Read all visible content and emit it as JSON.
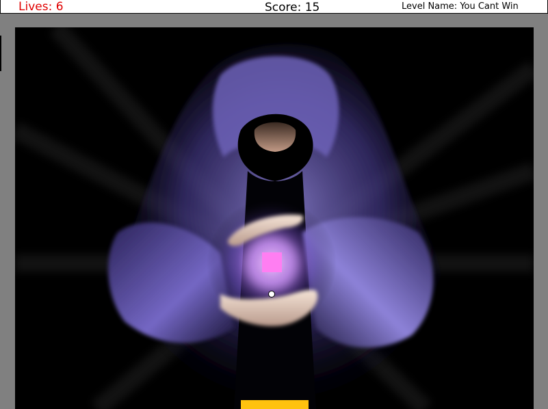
{
  "hud": {
    "lives_text": "Lives: 6",
    "score_text": "Score: 15",
    "level_text": "Level Name: You Cant Win"
  },
  "colors": {
    "lives": "#e00000",
    "block": "#ff7ef2",
    "paddle": "#ffc20e",
    "frame": "#808080",
    "robe": "#4a3f8c"
  },
  "scene": {
    "background_art": "hooded-wizard-holding-glowing-orb"
  }
}
